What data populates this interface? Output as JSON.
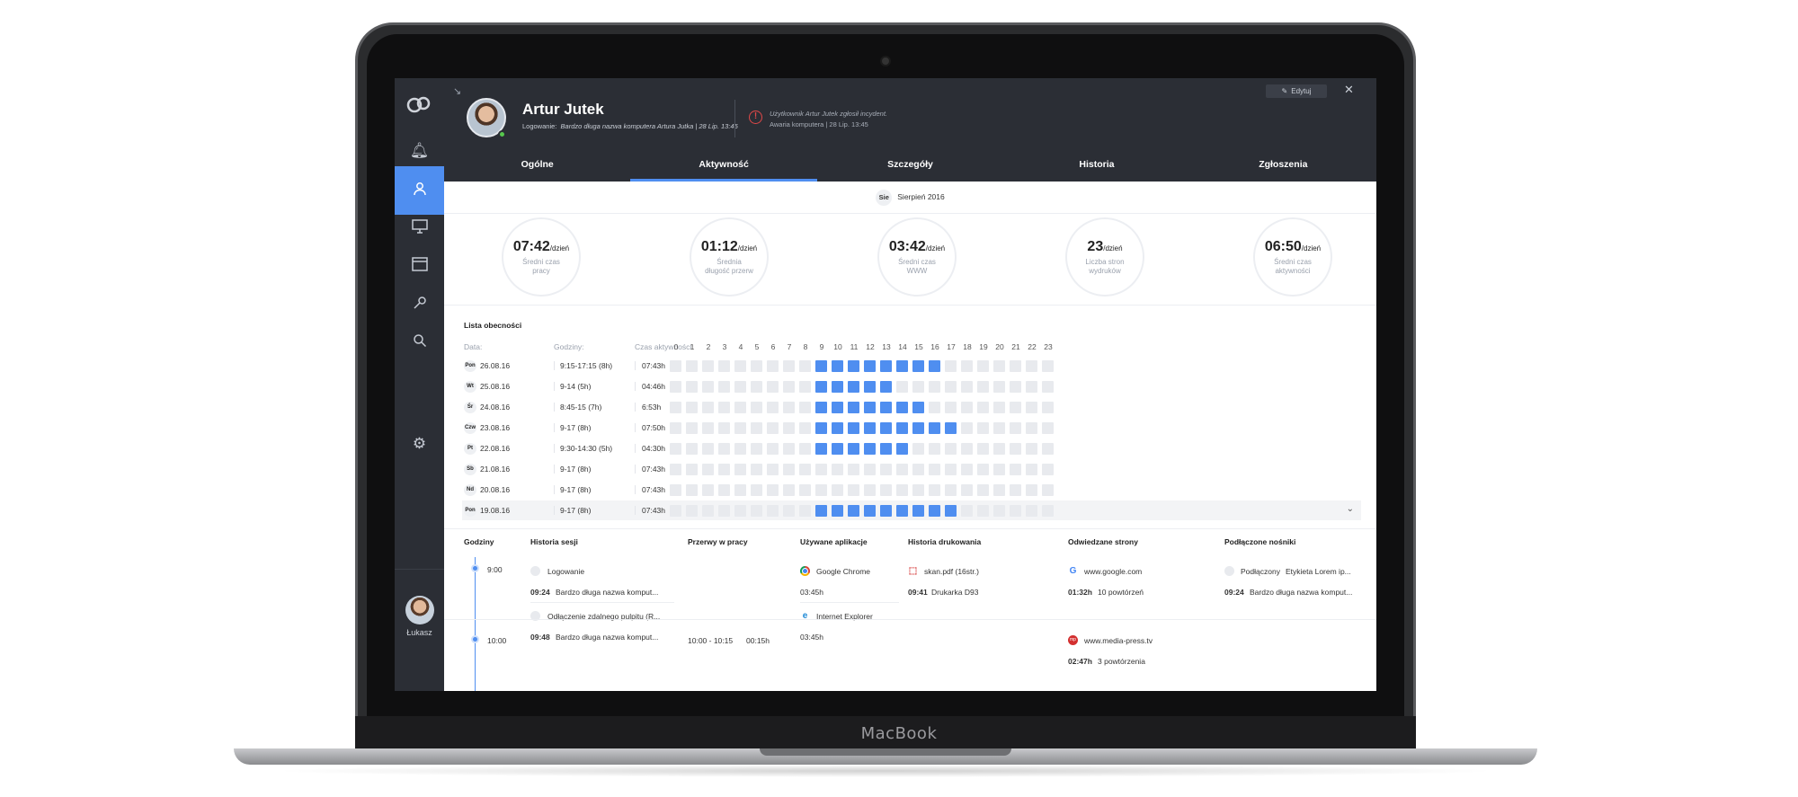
{
  "device": {
    "brand": "MacBook"
  },
  "sidebar": {
    "user_label": "Łukasz"
  },
  "header": {
    "name": "Artur Jutek",
    "login_label": "Logowanie:",
    "login_value": "Bardzo długa nazwa komputera Artura Jutka | 28 Lip. 13:45",
    "alert_line1": "Użytkownik Artur Jutek zgłosił incydent.",
    "alert_line2": "Awaria komputera | 28 Lip. 13:45",
    "edit_label": "Edytuj",
    "tabs": [
      {
        "label": "Ogólne"
      },
      {
        "label": "Aktywność"
      },
      {
        "label": "Szczegóły"
      },
      {
        "label": "Historia"
      },
      {
        "label": "Zgłoszenia"
      }
    ]
  },
  "period": {
    "pill": "Sie",
    "label": "Sierpień 2016"
  },
  "stats": [
    {
      "value": "07:42",
      "unit": "/dzień",
      "label": "Średni czas pracy"
    },
    {
      "value": "01:12",
      "unit": "/dzień",
      "label": "Średnia długość przerw"
    },
    {
      "value": "03:42",
      "unit": "/dzień",
      "label": "Średni czas WWW"
    },
    {
      "value": "23",
      "unit": "/dzień",
      "label": "Liczba stron wydruków"
    },
    {
      "value": "06:50",
      "unit": "/dzień",
      "label": "Średni czas aktywności"
    }
  ],
  "attendance": {
    "title": "Lista obecności",
    "col_date": "Data:",
    "col_hours": "Godziny:",
    "col_activity": "Czas aktywności:",
    "hour_labels": [
      "0",
      "1",
      "2",
      "3",
      "4",
      "5",
      "6",
      "7",
      "8",
      "9",
      "10",
      "11",
      "12",
      "13",
      "14",
      "15",
      "16",
      "17",
      "18",
      "19",
      "20",
      "21",
      "22",
      "23"
    ],
    "rows": [
      {
        "day": "Pon",
        "date": "26.08.16",
        "hours": "9:15-17:15 (8h)",
        "activity": "07:43h",
        "active": [
          9,
          10,
          11,
          12,
          13,
          14,
          15,
          16
        ]
      },
      {
        "day": "Wt",
        "date": "25.08.16",
        "hours": "9-14 (5h)",
        "activity": "04:46h",
        "active": [
          9,
          10,
          11,
          12,
          13
        ]
      },
      {
        "day": "Śr",
        "date": "24.08.16",
        "hours": "8:45-15 (7h)",
        "activity": "6:53h",
        "active": [
          9,
          10,
          11,
          12,
          13,
          14,
          15
        ]
      },
      {
        "day": "Czw",
        "date": "23.08.16",
        "hours": "9-17 (8h)",
        "activity": "07:50h",
        "active": [
          9,
          10,
          11,
          12,
          13,
          14,
          15,
          16,
          17
        ]
      },
      {
        "day": "Pt",
        "date": "22.08.16",
        "hours": "9:30-14:30 (5h)",
        "activity": "04:30h",
        "active": [
          9,
          10,
          11,
          12,
          13,
          14
        ]
      },
      {
        "day": "Sb",
        "date": "21.08.16",
        "hours": "9-17 (8h)",
        "activity": "07:43h",
        "active": []
      },
      {
        "day": "Nd",
        "date": "20.08.16",
        "hours": "9-17 (8h)",
        "activity": "07:43h",
        "active": []
      },
      {
        "day": "Pon",
        "date": "19.08.16",
        "hours": "9-17 (8h)",
        "activity": "07:43h",
        "active": [
          9,
          10,
          11,
          12,
          13,
          14,
          15,
          16,
          17
        ]
      }
    ]
  },
  "details": {
    "columns": [
      "Godziny",
      "Historia sesji",
      "Przerwy w pracy",
      "Używane aplikacje",
      "Historia drukowania",
      "Odwiedzane strony",
      "Podłączone nośniki"
    ],
    "slot1_time": "9:00",
    "slot2_time": "10:00",
    "session": [
      {
        "title": "Logowanie",
        "time": "09:24",
        "detail": "Bardzo długa nazwa komput..."
      },
      {
        "title": "Odłączenie zdalnego pulpitu (R...",
        "time": "09:48",
        "detail": "Bardzo długa nazwa komput..."
      }
    ],
    "breaks": [
      {
        "range": "10:00 - 10:15",
        "duration": "00:15h"
      }
    ],
    "apps": [
      {
        "name": "Google Chrome",
        "time": "03:45h"
      },
      {
        "name": "Internet Explorer",
        "time": "03:45h"
      }
    ],
    "print": {
      "file": "skan.pdf (16str.)",
      "time": "09:41",
      "printer": "Drukarka D93"
    },
    "sites": [
      {
        "url": "www.google.com",
        "time": "01:32h",
        "count": "10 powtórzeń"
      },
      {
        "url": "www.media-press.tv",
        "time": "02:47h",
        "count": "3 powtórzenia"
      }
    ],
    "media": {
      "status": "Podłączony",
      "label": "Etykieta Lorem ip...",
      "time": "09:24",
      "detail": "Bardzo długa nazwa komput..."
    }
  }
}
